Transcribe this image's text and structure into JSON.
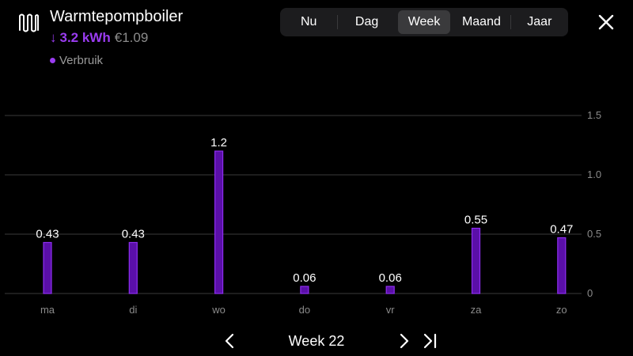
{
  "header": {
    "title": "Warmtepompboiler",
    "icon": "radiator-icon",
    "energy_arrow": "↓",
    "energy": "3.2 kWh",
    "cost": "€1.09",
    "legend_label": "Verbruik"
  },
  "period_tabs": [
    {
      "label": "Nu",
      "active": false
    },
    {
      "label": "Dag",
      "active": false
    },
    {
      "label": "Week",
      "active": true
    },
    {
      "label": "Maand",
      "active": false
    },
    {
      "label": "Jaar",
      "active": false
    }
  ],
  "navigation": {
    "label": "Week 22",
    "prev_icon": "chevron-left-icon",
    "next_icon": "chevron-right-icon",
    "last_icon": "skip-to-end-icon"
  },
  "colors": {
    "accent": "#9a3cf0",
    "bar_fill": "#5a0fa8",
    "bar_stroke": "#8e2df0",
    "grid": "#3a3a3a",
    "axis_text": "#8a8a8a"
  },
  "chart_data": {
    "type": "bar",
    "categories": [
      "ma",
      "di",
      "wo",
      "do",
      "vr",
      "za",
      "zo"
    ],
    "values": [
      0.43,
      0.43,
      1.2,
      0.06,
      0.06,
      0.55,
      0.47
    ],
    "data_labels": [
      "0.43",
      "0.43",
      "1.2",
      "0.06",
      "0.06",
      "0.55",
      "0.47"
    ],
    "ylim": [
      0,
      1.5
    ],
    "yticks": [
      0,
      0.5,
      1.0,
      1.5
    ],
    "ytick_labels": [
      "0",
      "0.5",
      "1.0",
      "1.5"
    ],
    "grid": true,
    "y_axis_side": "right"
  }
}
